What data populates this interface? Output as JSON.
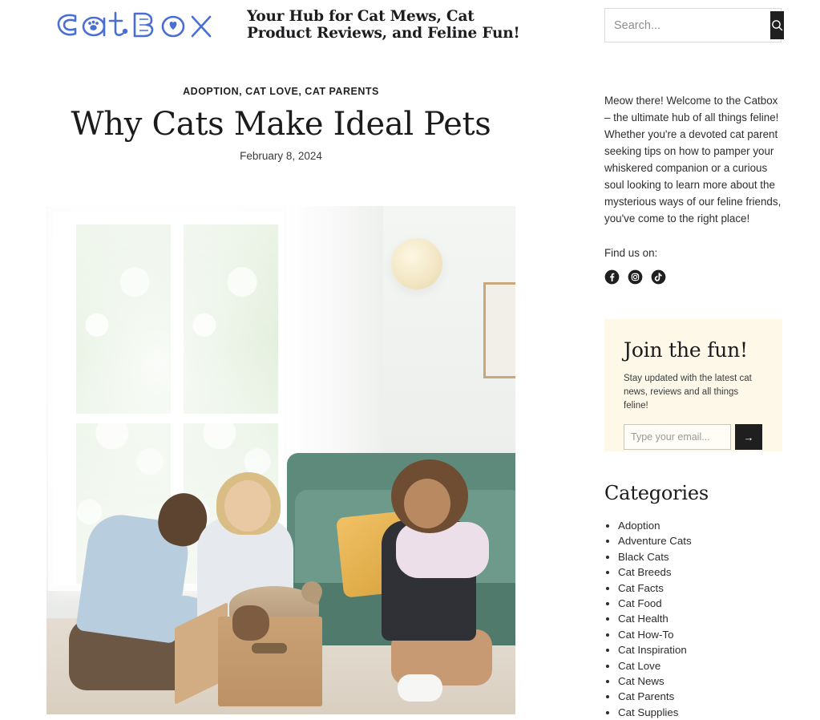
{
  "site": {
    "logo_text": "CatBox",
    "tagline": "Your Hub for Cat Mews, Cat Product Reviews, and Feline Fun!"
  },
  "search": {
    "placeholder": "Search...",
    "value": "",
    "button_icon": "search-icon"
  },
  "post": {
    "categories_line": "ADOPTION, CAT LOVE, CAT PARENTS",
    "title": "Why Cats Make Ideal Pets",
    "date": "February 8, 2024",
    "featured_image_alt": "Family with a child opening a cardboard box with a pet inside in a bright living room"
  },
  "sidebar": {
    "intro": "Meow there! Welcome to the Catbox – the ultimate hub of all things feline! Whether you're a devoted cat parent seeking tips on how to pamper your whiskered companion or a curious soul looking to learn more about the mysterious ways of our feline friends, you've come to the right place!",
    "find_us_label": "Find us on:",
    "socials": [
      {
        "name": "facebook-icon",
        "label": "Facebook"
      },
      {
        "name": "instagram-icon",
        "label": "Instagram"
      },
      {
        "name": "tiktok-icon",
        "label": "TikTok"
      }
    ]
  },
  "newsletter": {
    "title": "Join the fun!",
    "subtitle": "Stay updated with the latest cat news, reviews and all things feline!",
    "email_placeholder": "Type your email...",
    "email_value": "",
    "submit_label": "→",
    "background_color": "#fdf8e8"
  },
  "categories": {
    "heading": "Categories",
    "items": [
      "Adoption",
      "Adventure Cats",
      "Black Cats",
      "Cat Breeds",
      "Cat Facts",
      "Cat Food",
      "Cat Health",
      "Cat How-To",
      "Cat Inspiration",
      "Cat Love",
      "Cat News",
      "Cat Parents",
      "Cat Supplies"
    ]
  },
  "colors": {
    "accent_dark": "#1f1f1f",
    "logo_blue": "#4a6fd4",
    "cream": "#fdf8e8",
    "text": "#1f2021"
  }
}
